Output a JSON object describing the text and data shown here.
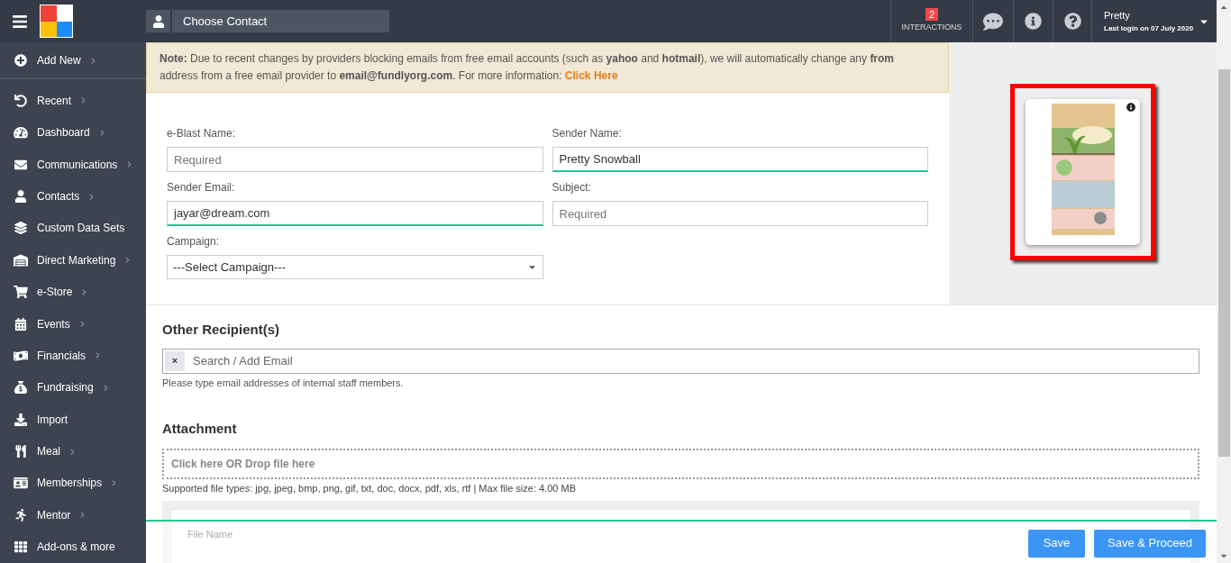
{
  "topbar": {
    "contact_search": {
      "placeholder": "Choose Contact"
    },
    "interactions": {
      "count": "2",
      "label": "INTERACTIONS"
    },
    "user": {
      "name": "Pretty",
      "last_login": "Last login on 07 July 2020"
    }
  },
  "sidebar": {
    "items": [
      {
        "label": "Add New",
        "has_submenu": true
      },
      {
        "label": "Recent",
        "has_submenu": true
      },
      {
        "label": "Dashboard",
        "has_submenu": true
      },
      {
        "label": "Communications",
        "has_submenu": true
      },
      {
        "label": "Contacts",
        "has_submenu": true
      },
      {
        "label": "Custom Data Sets",
        "has_submenu": false
      },
      {
        "label": "Direct Marketing",
        "has_submenu": true
      },
      {
        "label": "e-Store",
        "has_submenu": true
      },
      {
        "label": "Events",
        "has_submenu": true
      },
      {
        "label": "Financials",
        "has_submenu": true
      },
      {
        "label": "Fundraising",
        "has_submenu": true
      },
      {
        "label": "Import",
        "has_submenu": false
      },
      {
        "label": "Meal",
        "has_submenu": true
      },
      {
        "label": "Memberships",
        "has_submenu": true
      },
      {
        "label": "Mentor",
        "has_submenu": true
      },
      {
        "label": "Add-ons & more",
        "has_submenu": false
      }
    ]
  },
  "notice": {
    "text": "**Note:** Due to recent changes by providers blocking emails from free email accounts (such as **yahoo** and **hotmail**), we will automatically change any **from** address from a free email provider to **email@fundlyorg.com**. For more information:",
    "link": "Click Here"
  },
  "form": {
    "fields": [
      {
        "label": "e-Blast Name:",
        "kind": "text",
        "placeholder": "Required",
        "focused": false
      },
      {
        "label": "Sender Name:",
        "kind": "text",
        "value": "Pretty Snowball",
        "focused": true
      },
      {
        "label": "Sender Email:",
        "kind": "text",
        "value": "jayar@dream.com",
        "focused": true
      },
      {
        "label": "Subject:",
        "kind": "text",
        "placeholder": "Required",
        "focused": false
      },
      {
        "label": "Campaign:",
        "kind": "select",
        "value": "---Select Campaign---",
        "focused": false
      }
    ]
  },
  "preview": {
    "highlighted": true
  },
  "recipients": {
    "heading": "Other Recipient(s)",
    "placeholder": "Search / Add Email",
    "clear": "×",
    "help": "Please type email addresses of internal staff members."
  },
  "attachment": {
    "heading": "Attachment",
    "dropzone": "Click here OR Drop file here",
    "help": "Supported file types: jpg, jpeg, bmp, png, gif, txt, doc, docx, pdf, xls, rtf | Max file size: 4.00 MB",
    "columns": [
      "File Name"
    ]
  },
  "footer": {
    "buttons": [
      "Save",
      "Save & Proceed"
    ]
  }
}
